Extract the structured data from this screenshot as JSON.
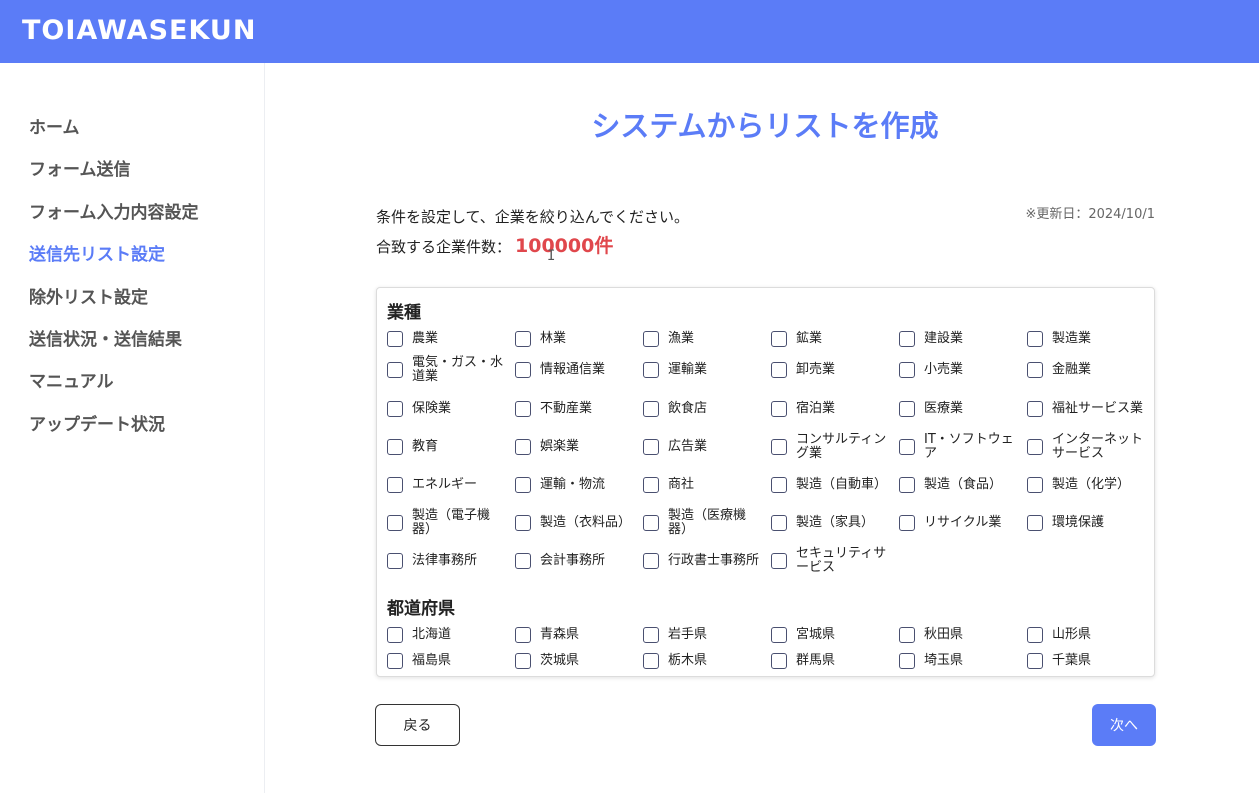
{
  "app": {
    "name": "TOIAWASEKUN"
  },
  "sidebar": {
    "items": [
      {
        "label": "ホーム",
        "active": false
      },
      {
        "label": "フォーム送信",
        "active": false
      },
      {
        "label": "フォーム入力内容設定",
        "active": false
      },
      {
        "label": "送信先リスト設定",
        "active": true
      },
      {
        "label": "除外リスト設定",
        "active": false
      },
      {
        "label": "送信状況・送信結果",
        "active": false
      },
      {
        "label": "マニュアル",
        "active": false
      },
      {
        "label": "アップデート状況",
        "active": false
      }
    ]
  },
  "main": {
    "title": "システムからリストを作成",
    "instruction": "条件を設定して、企業を絞り込んでください。",
    "updated": "※更新日：2024/10/1",
    "count_label": "合致する企業件数：",
    "count_value": "100000件"
  },
  "industry": {
    "title": "業種",
    "options": [
      "農業",
      "林業",
      "漁業",
      "鉱業",
      "建設業",
      "製造業",
      "電気・ガス・水道業",
      "情報通信業",
      "運輸業",
      "卸売業",
      "小売業",
      "金融業",
      "保険業",
      "不動産業",
      "飲食店",
      "宿泊業",
      "医療業",
      "福祉サービス業",
      "教育",
      "娯楽業",
      "広告業",
      "コンサルティング業",
      "IT・ソフトウェア",
      "インターネットサービス",
      "エネルギー",
      "運輸・物流",
      "商社",
      "製造（自動車）",
      "製造（食品）",
      "製造（化学）",
      "製造（電子機器）",
      "製造（衣料品）",
      "製造（医療機器）",
      "製造（家具）",
      "リサイクル業",
      "環境保護",
      "法律事務所",
      "会計事務所",
      "行政書士事務所",
      "セキュリティサービス"
    ]
  },
  "prefecture": {
    "title": "都道府県",
    "options": [
      "北海道",
      "青森県",
      "岩手県",
      "宮城県",
      "秋田県",
      "山形県",
      "福島県",
      "茨城県",
      "栃木県",
      "群馬県",
      "埼玉県",
      "千葉県"
    ]
  },
  "buttons": {
    "back": "戻る",
    "next": "次へ"
  },
  "colors": {
    "accent": "#5b7cf7",
    "count": "#e0474c"
  }
}
